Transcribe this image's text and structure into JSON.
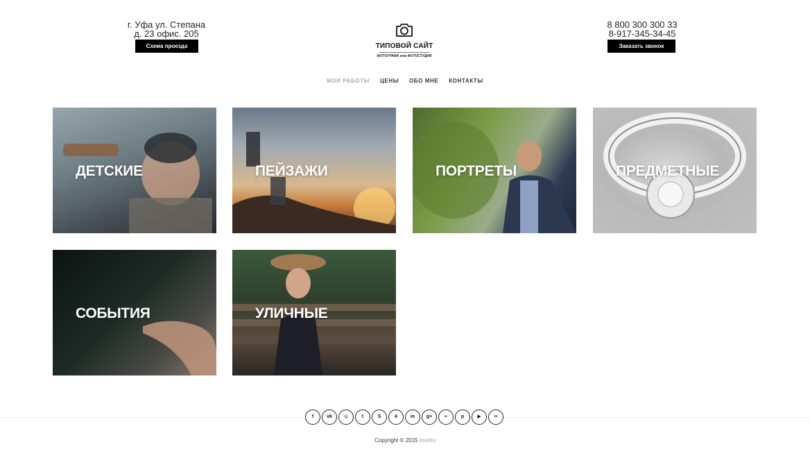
{
  "header": {
    "address": {
      "line1": "г. Уфа ул. Степана",
      "line2": "д. 23 офис. 205",
      "button": "Схема проезда"
    },
    "logo": {
      "title": "ТИПОВОЙ САЙТ",
      "subtitle": "ФОТОГРАФА или ФОТОСТУДИИ"
    },
    "phones": {
      "line1": "8 800 300 300 33",
      "line2": "8-917-345-34-45",
      "button": "Заказать звонок"
    }
  },
  "nav": {
    "items": [
      "МОИ РАБОТЫ",
      "ЦЕНЫ",
      "ОБО МНЕ",
      "КОНТАКТЫ"
    ],
    "active": "МОИ РАБОТЫ"
  },
  "gallery": {
    "tiles": [
      "ДЕТСКИЕ",
      "ПЕЙЗАЖИ",
      "ПОРТРЕТЫ",
      "ПРЕДМЕТНЫЕ",
      "СОБЫТИЯ",
      "УЛИЧНЫЕ"
    ]
  },
  "footer": {
    "socials": [
      {
        "icon": "facebook-icon",
        "glyph": "f"
      },
      {
        "icon": "vk-icon",
        "glyph": "vk"
      },
      {
        "icon": "instagram-icon",
        "glyph": "◎"
      },
      {
        "icon": "twitter-icon",
        "glyph": "t"
      },
      {
        "icon": "skype-icon",
        "glyph": "S"
      },
      {
        "icon": "foursquare-icon",
        "glyph": "4"
      },
      {
        "icon": "linkedin-icon",
        "glyph": "in"
      },
      {
        "icon": "google-plus-icon",
        "glyph": "g+"
      },
      {
        "icon": "rss-icon",
        "glyph": "≈"
      },
      {
        "icon": "pinterest-icon",
        "glyph": "p"
      },
      {
        "icon": "youtube-icon",
        "glyph": "▶"
      },
      {
        "icon": "flickr-icon",
        "glyph": "••"
      }
    ],
    "copyright_prefix": "Copyright © 2015",
    "copyright_brand": "Invicto"
  }
}
